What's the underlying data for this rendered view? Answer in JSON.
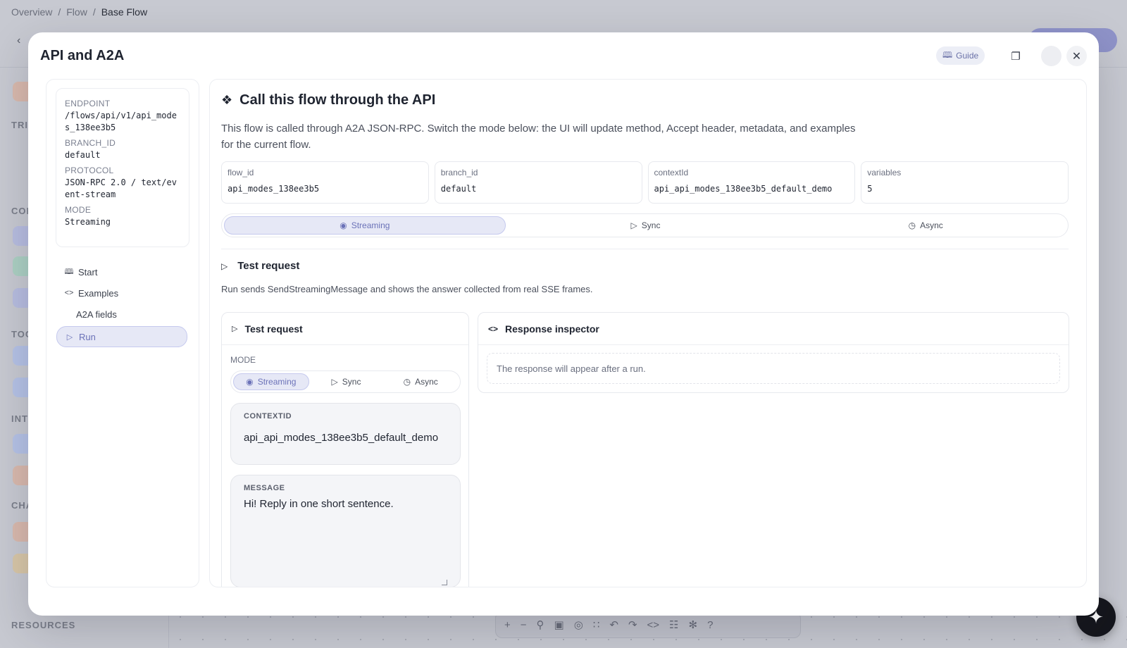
{
  "background": {
    "breadcrumb": [
      "Overview",
      "Flow",
      "Base Flow"
    ],
    "sidebar_labels": [
      "TRI",
      "COF",
      "TOC",
      "INTI",
      "CHA"
    ],
    "resources_label": "RESOURCES"
  },
  "modal": {
    "title": "API and A2A",
    "guide_label": "Guide"
  },
  "info": {
    "endpoint_key": "ENDPOINT",
    "endpoint_val": "/flows/api/v1/api_modes_138ee3b5",
    "branch_key": "BRANCH_ID",
    "branch_val": "default",
    "protocol_key": "PROTOCOL",
    "protocol_val": "JSON-RPC 2.0 / text/event-stream",
    "mode_key": "MODE",
    "mode_val": "Streaming"
  },
  "nav": {
    "start": "Start",
    "examples": "Examples",
    "a2a_fields": "A2A fields",
    "run": "Run"
  },
  "main": {
    "title": "Call this flow through the API",
    "description": "This flow is called through A2A JSON-RPC. Switch the mode below: the UI will update method, Accept header, metadata, and examples for the current flow.",
    "fields": [
      {
        "key": "flow_id",
        "value": "api_modes_138ee3b5"
      },
      {
        "key": "branch_id",
        "value": "default"
      },
      {
        "key": "contextId",
        "value": "api_api_modes_138ee3b5_default_demo"
      },
      {
        "key": "variables",
        "value": "5"
      }
    ],
    "modes": [
      "Streaming",
      "Sync",
      "Async"
    ],
    "test_request_title": "Test request",
    "test_request_desc": "Run sends SendStreamingMessage and shows the answer collected from real SSE frames."
  },
  "request": {
    "title": "Test request",
    "mode_label": "MODE",
    "modes": [
      "Streaming",
      "Sync",
      "Async"
    ],
    "context_key": "CONTEXTID",
    "context_val": "api_api_modes_138ee3b5_default_demo",
    "message_key": "MESSAGE",
    "message_val": "Hi! Reply in one short sentence."
  },
  "response": {
    "title": "Response inspector",
    "empty": "The response will appear after a run."
  },
  "colors": {
    "accent": "#6b72b8",
    "accent_bg": "#e6e8f6"
  }
}
